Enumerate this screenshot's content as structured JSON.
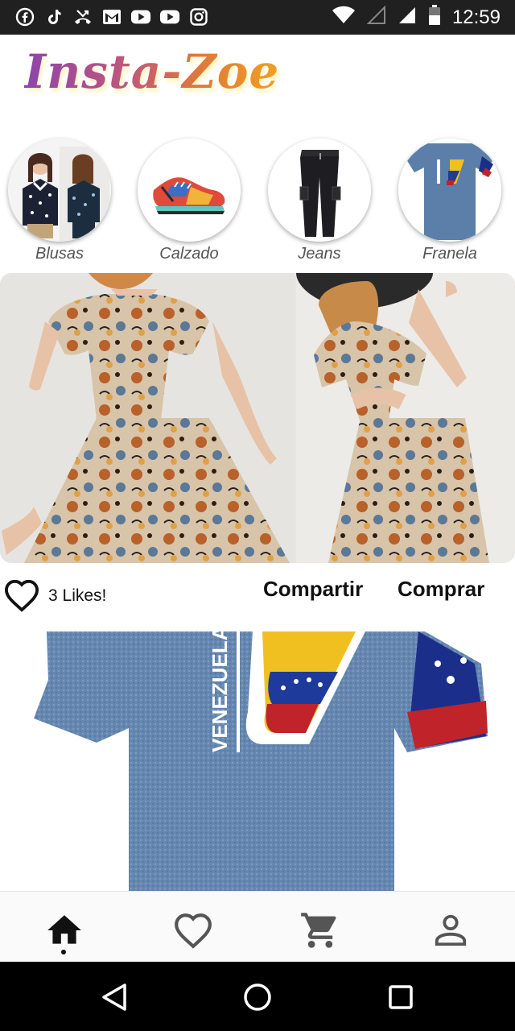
{
  "status_bar": {
    "time": "12:59",
    "left_icons": [
      "facebook-icon",
      "tiktok-icon",
      "missed-call-icon",
      "gmail-icon",
      "youtube-icon",
      "youtube-icon",
      "instagram-icon"
    ],
    "right_icons": [
      "wifi-icon",
      "signal-empty-icon",
      "signal-icon",
      "battery-icon"
    ]
  },
  "app": {
    "logo": "Insta-Zoe"
  },
  "categories": [
    {
      "label": "Blusas"
    },
    {
      "label": "Calzado"
    },
    {
      "label": "Jeans"
    },
    {
      "label": "Franela"
    }
  ],
  "post": {
    "likes_text": "3 Likes!",
    "share_label": "Compartir",
    "buy_label": "Comprar"
  },
  "bottom_nav": [
    "home-icon",
    "heart-icon",
    "cart-icon",
    "profile-icon"
  ],
  "system_nav": [
    "back-icon",
    "home-circle-icon",
    "recents-icon"
  ],
  "colors": {
    "status_bar": "#202020",
    "system_nav": "#000000",
    "logo_start": "#8e44ad",
    "logo_end": "#f0a020"
  }
}
